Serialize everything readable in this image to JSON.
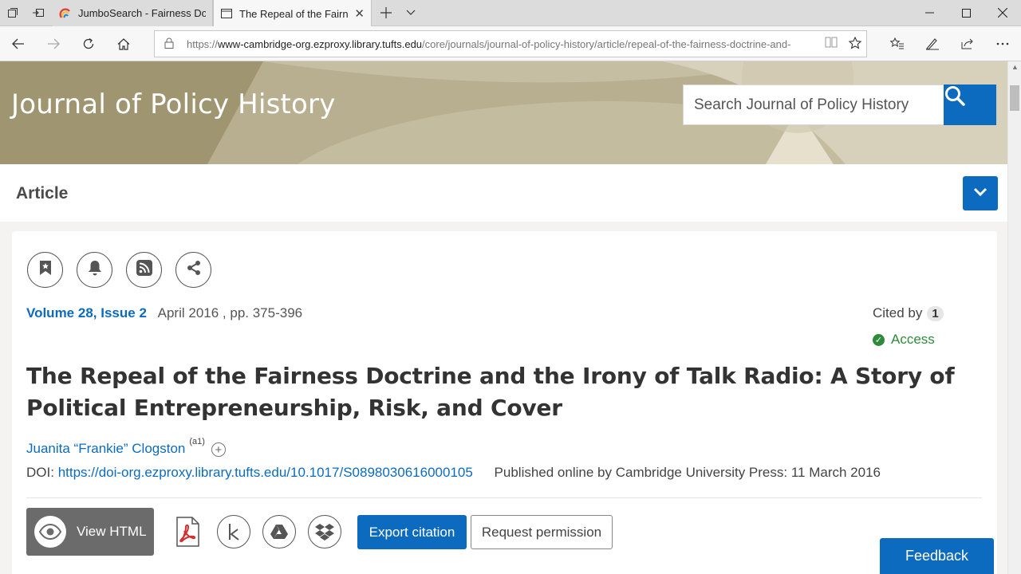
{
  "browser": {
    "tabs": [
      {
        "title": "JumboSearch - Fairness Doc",
        "active": false
      },
      {
        "title": "The Repeal of the Fairne",
        "active": true
      }
    ],
    "url_prefix": "https://",
    "url_host": "www-cambridge-org.ezproxy.library.tufts.edu",
    "url_path": "/core/journals/journal-of-policy-history/article/repeal-of-the-fairness-doctrine-and-"
  },
  "header": {
    "journal_title": "Journal of Policy History",
    "search_placeholder": "Search Journal of Policy History"
  },
  "article_bar": {
    "label": "Article"
  },
  "article": {
    "volume": "Volume 28",
    "separator": ",",
    "issue": "Issue 2",
    "date_pages": "April 2016 , pp. 375-396",
    "cited_by_label": "Cited by",
    "cited_by_count": "1",
    "access_label": "Access",
    "title": "The Repeal of the Fairness Doctrine and the Irony of Talk Radio: A Story of Political Entrepreneurship, Risk, and Cover",
    "author": "Juanita “Frankie” Clogston",
    "author_affil": "(a1)",
    "doi_label": "DOI:",
    "doi_url": "https://doi-org.ezproxy.library.tufts.edu/10.1017/S0898030616000105",
    "published": "Published online by Cambridge University Press: 11 March 2016"
  },
  "toolbar": {
    "view_html": "View HTML",
    "export_citation": "Export citation",
    "request_permission": "Request permission"
  },
  "feedback": "Feedback",
  "colors": {
    "accent": "#0d6bbf",
    "banner": "#b9b091",
    "access": "#2e8b3a"
  }
}
